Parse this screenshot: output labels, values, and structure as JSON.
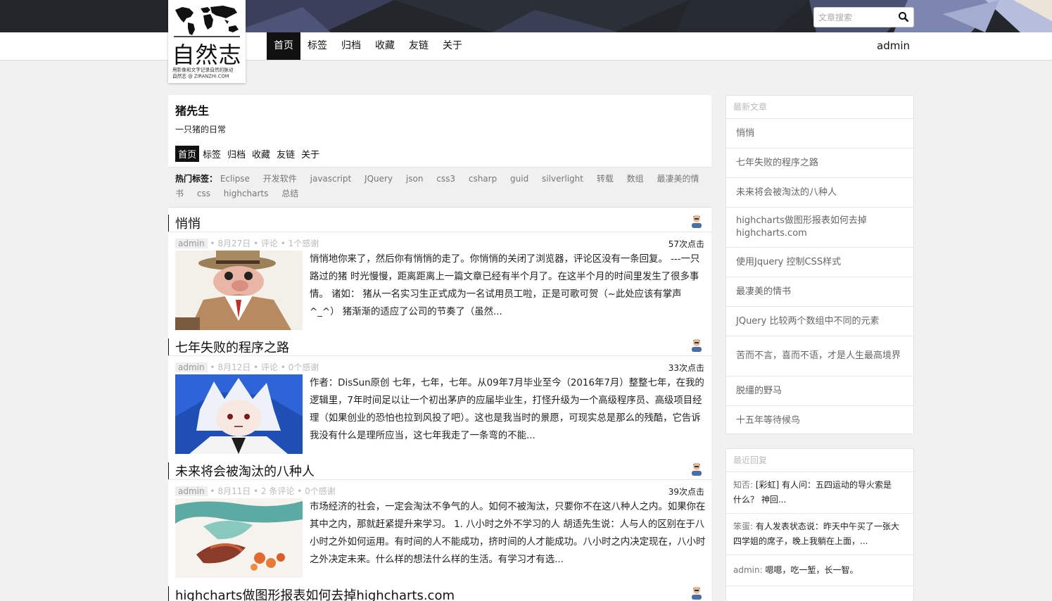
{
  "search": {
    "placeholder": "文章搜索"
  },
  "nav": {
    "items": [
      "首页",
      "标签",
      "归档",
      "收藏",
      "友链",
      "关于"
    ],
    "user": "admin"
  },
  "logo": {
    "title": "自然志",
    "tagline": "用影像和文字记录自然的脉动",
    "domain": "自然志 @ ZIRANZHI.COM"
  },
  "blog": {
    "name": "猪先生",
    "description": "一只猪的日常",
    "sub_nav": [
      "首页",
      "标签",
      "归档",
      "收藏",
      "友链",
      "关于"
    ],
    "hot_tags_label": "热门标签：",
    "hot_tags": [
      "Eclipse",
      "开发软件",
      "javascript",
      "JQuery",
      "json",
      "css3",
      "csharp",
      "guid",
      "silverlight",
      "转载",
      "数组",
      "最凄美的情书",
      "css",
      "highcharts",
      "总结"
    ]
  },
  "posts": [
    {
      "title": "悄悄",
      "author": "admin",
      "meta": " • 8月27日 • 评论 • 1个感谢",
      "clicks": "57次点击",
      "excerpt": "悄悄地你来了，然后你有悄悄的走了。你悄悄的关闭了浏览器，评论区没有一条回复。 ---一只路过的猪 时光慢慢，距离距离上一篇文章已经有半个月了。在这半个月的时间里发生了很多事情。 诸如： 猪从一名实习生正式成为一名试用员工啦，正是可歌可贺（~此处应该有掌声^_^） 猪渐渐的适应了公司的节奏了（虽然..."
    },
    {
      "title": "七年失败的程序之路",
      "author": "admin",
      "meta": " • 8月12日 • 评论 • 0个感谢",
      "clicks": "33次点击",
      "excerpt": "作者：DisSun原创 七年，七年，七年。从09年7月毕业至今（2016年7月）整整七年，在我的逻辑里，7年时间足以让一个初出茅庐的应届毕业生，打怪升级为一个高级程序员、高级项目经理（如果创业的恐怕也拉到风投了吧）。这也是我当时的景愿，可现实总是那么的残酷，它告诉我没有什么是理所应当，这七年我走了一条弯的不能..."
    },
    {
      "title": "未来将会被淘汰的八种人",
      "author": "admin",
      "meta": " • 8月11日 • 2 条评论 • 0个感谢",
      "clicks": "39次点击",
      "excerpt": "市场经济的社会，一定会淘汰不争气的人。如何不被淘汰，只要你不在这八种人之内。如果你在其中之内，那就赶紧提升来学习。 1. 八小时之外不学习的人 胡适先生说：人与人的区别在于八小时之外如何运用。有时间的人不能成功，挤时间的人才能成功。八小时之内决定现在，八小时之外决定未来。什么样的想法什么样的生活。有学习才有选..."
    },
    {
      "title": "highcharts做图形报表如何去掉highcharts.com"
    }
  ],
  "sidebar": {
    "latest_title": "最新文章",
    "latest": [
      "悄悄",
      "七年失败的程序之路",
      "未来将会被淘汰的八种人",
      "highcharts做图形报表如何去掉highcharts.com",
      "使用Jquery 控制CSS样式",
      "最凄美的情书",
      "JQuery 比较两个数组中不同的元素",
      "苦而不言，喜而不语，才是人生最高境界",
      "脱缰的野马",
      "十五年等待候鸟"
    ],
    "replies_title": "最近回复",
    "replies": [
      {
        "who": "知否:",
        "text": " [彩虹] 有人问：五四运动的导火索是什么？ 神回..."
      },
      {
        "who": "笨蛋:",
        "text": " 有人发表状态说：昨天中午买了一张大四学姐的席子，晚上我躺在上面，..."
      },
      {
        "who": "admin:",
        "text": " 嗯嗯，吃一堑，长一智。"
      }
    ]
  },
  "colors": {
    "accent": "#111111",
    "banner": "#23272b",
    "page_bg": "#f1f1f1"
  },
  "icons": {
    "search": "search-icon",
    "avatar": "avatar-icon"
  }
}
